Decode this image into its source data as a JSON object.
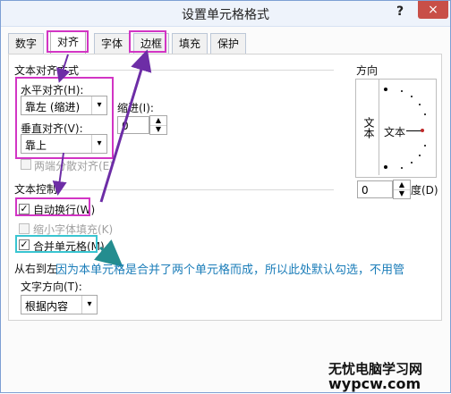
{
  "dialog": {
    "title": "设置单元格格式",
    "help": "?",
    "close": "×"
  },
  "tabs": [
    "数字",
    "对齐",
    "字体",
    "边框",
    "填充",
    "保护"
  ],
  "alignment": {
    "section_title": "文本对齐方式",
    "horizontal_label": "水平对齐(H):",
    "horizontal_value": "靠左 (缩进)",
    "indent_label": "缩进(I):",
    "indent_value": "0",
    "vertical_label": "垂直对齐(V):",
    "vertical_value": "靠上",
    "distributed_label": "两端分散对齐(E)"
  },
  "text_control": {
    "section_title": "文本控制",
    "wrap_label": "自动换行(W)",
    "shrink_label": "缩小字体填充(K)",
    "merge_label": "合并单元格(M)",
    "wrap_checked": true,
    "shrink_checked": false,
    "merge_checked": true
  },
  "rtl": {
    "section_title": "从右到左",
    "direction_label": "文字方向(T):",
    "direction_value": "根据内容"
  },
  "orientation": {
    "title": "方向",
    "vertical_text": "文本",
    "horizontal_text": "文本",
    "degree_value": "0",
    "degree_label": "度(D)"
  },
  "annotation": {
    "text": "因为本单元格是合并了两个单元格而成，所以此处默认勾选，不用管"
  },
  "watermark": {
    "line1": "无忧电脑学习网",
    "line2": "wypcw.com"
  },
  "colors": {
    "highlight_pink": "#d235c4",
    "highlight_cyan": "#39c5d1",
    "annotation_text": "#1b7db9"
  }
}
